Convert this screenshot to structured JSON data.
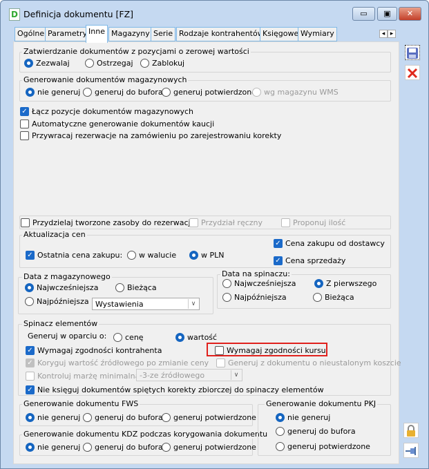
{
  "window": {
    "title": "Definicja dokumentu [FZ]",
    "app_icon": "D",
    "minimize": "▭",
    "maximize": "▣",
    "close": "✕"
  },
  "tabs": [
    "Ogólne",
    "Parametry",
    "Inne",
    "Magazyny",
    "Serie",
    "Rodzaje kontrahentów",
    "Księgowe",
    "Wymiary"
  ],
  "tab_scroll": {
    "left": "◂",
    "right": "▸"
  },
  "zero_value": {
    "legend": "Zatwierdzanie dokumentów z pozycjami o zerowej wartości",
    "options": [
      "Zezwalaj",
      "Ostrzegaj",
      "Zablokuj"
    ],
    "selected": 0
  },
  "warehouse_gen": {
    "legend": "Generowanie dokumentów magazynowych",
    "options": [
      "nie generuj",
      "generuj do bufora",
      "generuj potwierdzone",
      "wg magazynu WMS"
    ],
    "selected": 0
  },
  "checks": [
    {
      "label": "Łącz pozycje dokumentów magazynowych",
      "checked": true
    },
    {
      "label": "Automatyczne generowanie dokumentów kaucji",
      "checked": false
    },
    {
      "label": "Przywracaj rezerwacje na zamówieniu po zarejestrowaniu korekty",
      "checked": false
    }
  ],
  "reservation": {
    "assign": "Przydzielaj tworzone zasoby do rezerwacji",
    "manual": "Przydział ręczny",
    "propose": "Proponuj ilość"
  },
  "prices": {
    "legend": "Aktualizacja cen",
    "last_price": "Ostatnia cena zakupu:",
    "in_currency": "w walucie",
    "in_pln": "w PLN",
    "supplier_price": "Cena zakupu od dostawcy",
    "sale_price": "Cena sprzedaży"
  },
  "date_wh": {
    "legend": "Data z magazynowego",
    "earliest": "Najwcześniejsza",
    "current": "Bieżąca",
    "latest": "Najpóźniejsza",
    "select_value": "Wystawienia"
  },
  "date_clip": {
    "legend": "Data na spinaczu:",
    "earliest": "Najwcześniejsza",
    "first": "Z pierwszego",
    "latest": "Najpóźniejsza",
    "current": "Bieżąca"
  },
  "clip": {
    "legend": "Spinacz elementów",
    "based_on": "Generuj w oparciu o:",
    "price": "cenę",
    "value": "wartość",
    "contractor": "Wymagaj zgodności kontrahenta",
    "rate": "Wymagaj zgodności kursu",
    "correct": "Koryguj wartość źródłowego po zmianie ceny",
    "gen_cost": "Generuj z dokumentu o nieustalonym koszcie",
    "margin": "Kontroluj marżę minimalną",
    "margin_select": "-3-ze źródłowego",
    "no_post": "Nie księguj dokumentów spiętych korekty zbiorczej do spinaczy elementów"
  },
  "fws": {
    "legend": "Generowanie dokumentu FWS",
    "options": [
      "nie generuj",
      "generuj do bufora",
      "generuj potwierdzone"
    ]
  },
  "kdz": {
    "legend": "Generowanie dokumentu KDZ podczas korygowania dokumentu",
    "options": [
      "nie generuj",
      "generuj do bufora",
      "generuj potwierdzone"
    ]
  },
  "pkj": {
    "legend": "Generowanie dokumentu PKJ",
    "options": [
      "nie generuj",
      "generuj do bufora",
      "generuj potwierdzone"
    ]
  },
  "colors": {
    "accent": "#1565c0",
    "highlight": "#e0201c"
  }
}
